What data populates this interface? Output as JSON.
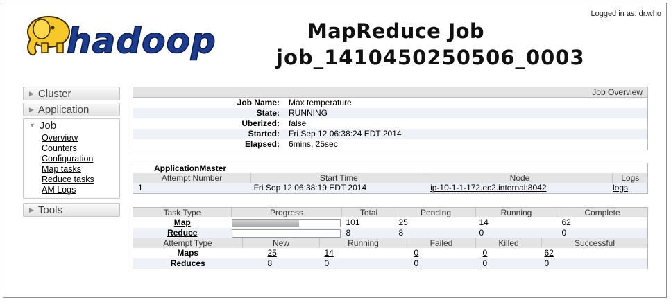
{
  "header": {
    "logged_in": "Logged in as: dr.who",
    "logo_text": "hadoop",
    "title_line1": "MapReduce Job",
    "title_line2": "job_1410450250506_0003"
  },
  "sidebar": {
    "cluster": "Cluster",
    "application": "Application",
    "job": "Job",
    "job_links": [
      "Overview",
      "Counters",
      "Configuration",
      "Map tasks",
      "Reduce tasks",
      "AM Logs"
    ],
    "tools": "Tools"
  },
  "overview": {
    "heading": "Job Overview",
    "rows": [
      {
        "key": "Job Name:",
        "value": "Max temperature"
      },
      {
        "key": "State:",
        "value": "RUNNING"
      },
      {
        "key": "Uberized:",
        "value": "false"
      },
      {
        "key": "Started:",
        "value": "Fri Sep 12 06:38:24 EDT 2014"
      },
      {
        "key": "Elapsed:",
        "value": "6mins, 25sec"
      }
    ]
  },
  "app_master": {
    "title": "ApplicationMaster",
    "headers": [
      "Attempt Number",
      "Start Time",
      "Node",
      "Logs"
    ],
    "row": {
      "attempt": "1",
      "start": "Fri Sep 12 06:38:19 EDT 2014",
      "node": "ip-10-1-1-172.ec2.internal:8042",
      "logs": "logs"
    }
  },
  "tasks": {
    "headers": [
      "Task Type",
      "Progress",
      "Total",
      "Pending",
      "Running",
      "Complete"
    ],
    "map": {
      "type": "Map",
      "progress": 0.62,
      "total": "101",
      "pending": "25",
      "running": "14",
      "complete": "62"
    },
    "reduce": {
      "type": "Reduce",
      "progress": 0.0,
      "total": "8",
      "pending": "8",
      "running": "0",
      "complete": "0"
    }
  },
  "attempts": {
    "headers": [
      "Attempt Type",
      "New",
      "Running",
      "Failed",
      "Killed",
      "Successful"
    ],
    "maps": {
      "type": "Maps",
      "new": "25",
      "running": "14",
      "failed": "0",
      "killed": "0",
      "successful": "62"
    },
    "reduces": {
      "type": "Reduces",
      "new": "8",
      "running": "0",
      "failed": "0",
      "killed": "0",
      "successful": "0"
    }
  },
  "colors": {
    "row_alt": "#eef1f8",
    "header_bg": "#e4e4e4",
    "logo_yellow": "#f6c82a",
    "logo_blue": "#1c3d8f"
  }
}
